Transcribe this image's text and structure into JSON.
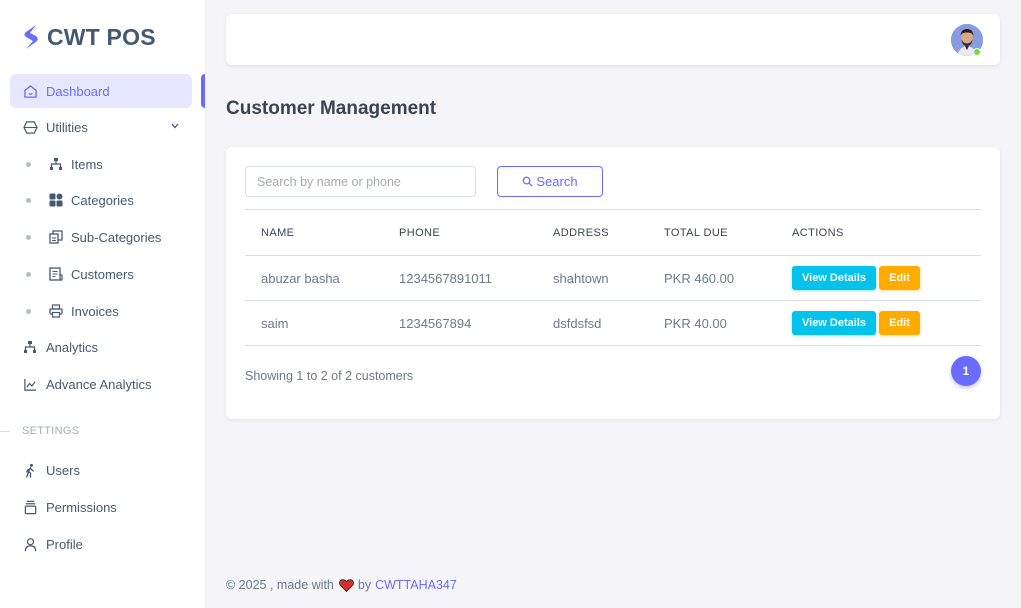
{
  "brand": {
    "name": "CWT POS"
  },
  "sidebar": {
    "items": [
      {
        "label": "Dashboard",
        "icon": "home-icon"
      },
      {
        "label": "Utilities",
        "icon": "cube-icon"
      },
      {
        "label": "Analytics",
        "icon": "sitemap-icon"
      },
      {
        "label": "Advance Analytics",
        "icon": "line-chart-icon"
      }
    ],
    "sub_items": [
      {
        "label": "Items",
        "icon": "sitemap-icon"
      },
      {
        "label": "Categories",
        "icon": "grid-icon"
      },
      {
        "label": "Sub-Categories",
        "icon": "copy-icon"
      },
      {
        "label": "Customers",
        "icon": "receipt-icon"
      },
      {
        "label": "Invoices",
        "icon": "printer-icon"
      }
    ],
    "section_label": "SETTINGS",
    "settings_items": [
      {
        "label": "Users",
        "icon": "walking-icon"
      },
      {
        "label": "Permissions",
        "icon": "stack-icon"
      },
      {
        "label": "Profile",
        "icon": "user-icon"
      }
    ]
  },
  "page": {
    "title": "Customer Management"
  },
  "search": {
    "placeholder": "Search by name or phone",
    "button_label": "Search"
  },
  "table": {
    "headers": [
      "NAME",
      "PHONE",
      "ADDRESS",
      "TOTAL DUE",
      "ACTIONS"
    ],
    "rows": [
      {
        "name": "abuzar basha",
        "phone": "1234567891011",
        "address": "shahtown",
        "due": "PKR 460.00"
      },
      {
        "name": "saim",
        "phone": "1234567894",
        "address": "dsfdsfsd",
        "due": "PKR 40.00"
      }
    ],
    "view_label": "View Details",
    "edit_label": "Edit"
  },
  "pagination": {
    "summary": "Showing 1 to 2 of 2 customers",
    "current_page": "1"
  },
  "footer": {
    "prefix": "© 2025 , made with",
    "by": "by",
    "author": "CWTTAHA347"
  },
  "colors": {
    "primary": "#696cff",
    "info": "#03c3ec",
    "warning": "#ffab00",
    "online": "#71dd37"
  }
}
